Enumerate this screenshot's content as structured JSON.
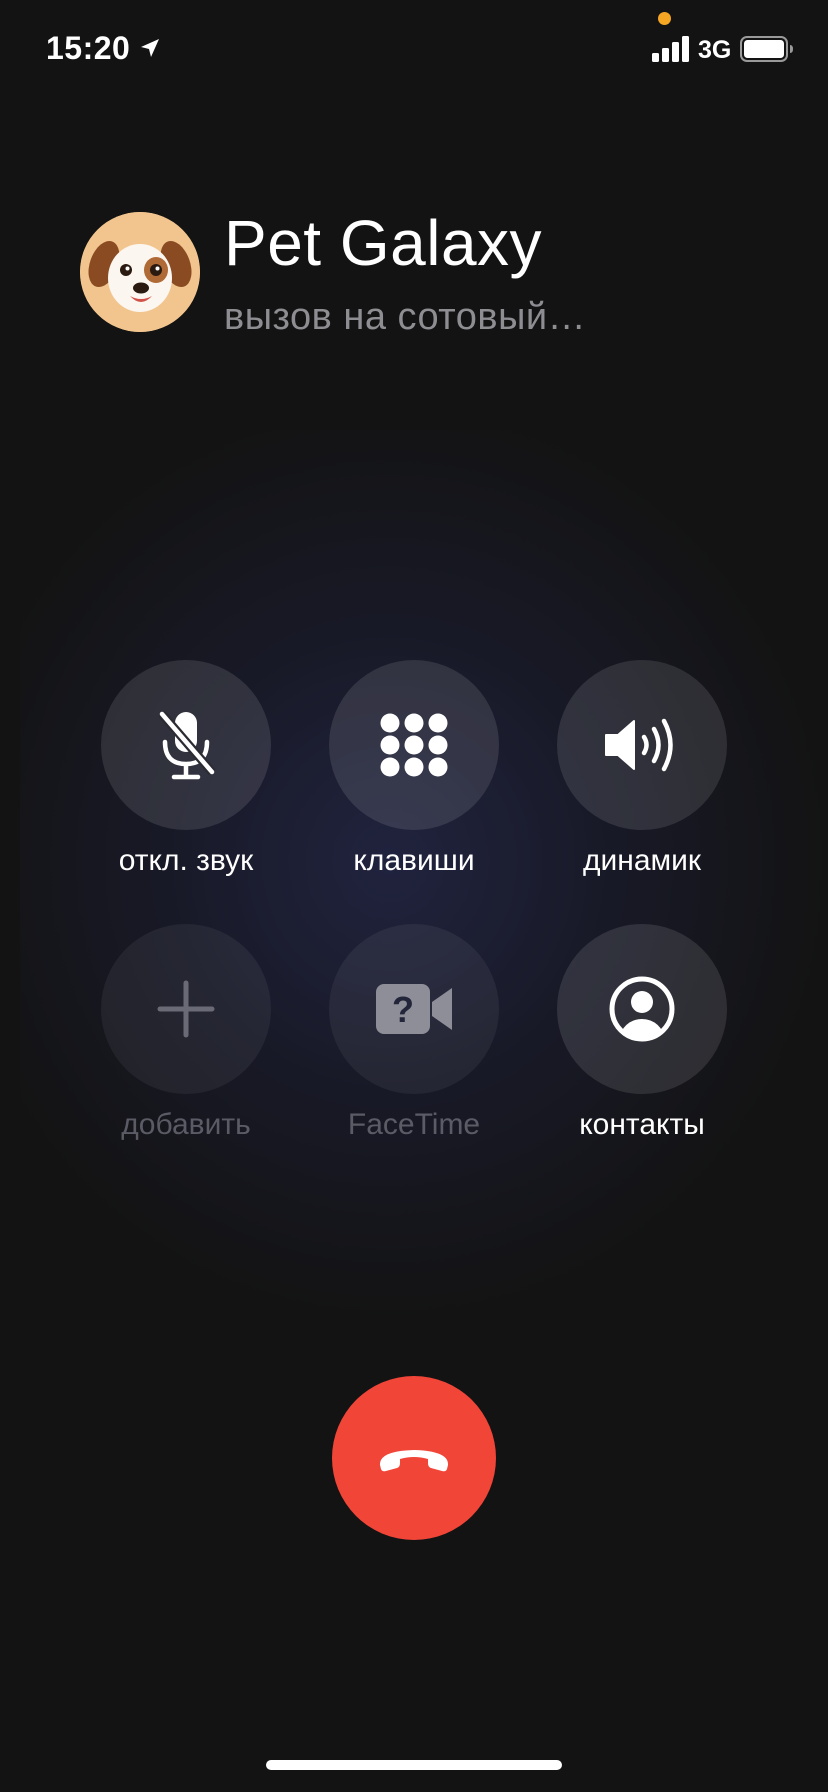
{
  "status_bar": {
    "time": "15:20",
    "network": "3G",
    "privacy_dot_color": "#f5a623",
    "icons": [
      "location-arrow-icon",
      "signal-bars-icon",
      "battery-icon"
    ]
  },
  "caller": {
    "name": "Pet Galaxy",
    "status": "вызов на сотовый…",
    "avatar_icon": "dog-memoji-avatar"
  },
  "controls": [
    {
      "label": "откл. звук",
      "icon": "mute-microphone-icon",
      "enabled": true
    },
    {
      "label": "клавиши",
      "icon": "keypad-icon",
      "enabled": true
    },
    {
      "label": "динамик",
      "icon": "speaker-icon",
      "enabled": true
    },
    {
      "label": "добавить",
      "icon": "plus-icon",
      "enabled": false
    },
    {
      "label": "FaceTime",
      "icon": "facetime-video-icon",
      "enabled": false
    },
    {
      "label": "контакты",
      "icon": "contact-person-icon",
      "enabled": true
    }
  ],
  "end_call": {
    "icon": "hang-up-phone-icon",
    "color": "#f14538"
  },
  "colors": {
    "background": "#131313",
    "secondary_text": "#8d8d92",
    "disabled": "#5b5b66"
  }
}
